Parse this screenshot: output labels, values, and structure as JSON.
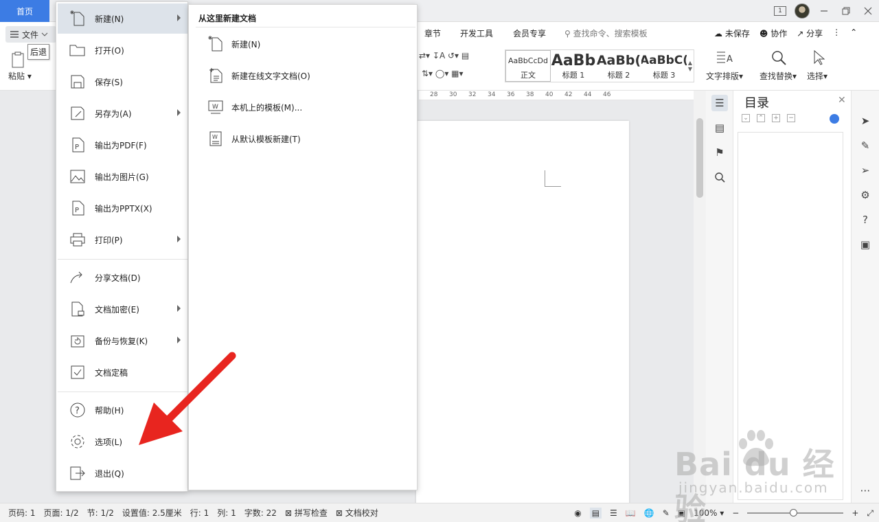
{
  "titlebar": {
    "home_tab": "首页",
    "badge": "1"
  },
  "ribbon": {
    "file_label": "文件",
    "tabs": {
      "chapter": "章节",
      "dev_tools": "开发工具",
      "member": "会员专享"
    },
    "search_cmd": "查找命令、搜索模板",
    "unsaved": "未保存",
    "collab": "协作",
    "share": "分享",
    "paste": "粘贴",
    "styles": [
      {
        "preview": "AaBbCcDd",
        "name": "正文"
      },
      {
        "preview": "AaBb",
        "name": "标题 1"
      },
      {
        "preview": "AaBb(",
        "name": "标题 2"
      },
      {
        "preview": "AaBbC(",
        "name": "标题 3"
      }
    ],
    "text_layout": "文字排版",
    "find_replace": "查找替换",
    "select": "选择"
  },
  "tooltip": "后退",
  "ruler_numbers": [
    "28",
    "30",
    "32",
    "34",
    "36",
    "38",
    "40",
    "42",
    "44",
    "46"
  ],
  "file_menu": [
    {
      "label": "新建(N)",
      "icon": "new-doc-icon"
    },
    {
      "label": "打开(O)",
      "icon": "folder-icon"
    },
    {
      "label": "保存(S)",
      "icon": "save-icon"
    },
    {
      "label": "另存为(A)",
      "icon": "save-as-icon"
    },
    {
      "label": "输出为PDF(F)",
      "icon": "pdf-icon"
    },
    {
      "label": "输出为图片(G)",
      "icon": "image-icon"
    },
    {
      "label": "输出为PPTX(X)",
      "icon": "pptx-icon"
    },
    {
      "label": "打印(P)",
      "icon": "printer-icon"
    },
    {
      "label": "分享文档(D)",
      "icon": "share-icon"
    },
    {
      "label": "文档加密(E)",
      "icon": "lock-doc-icon"
    },
    {
      "label": "备份与恢复(K)",
      "icon": "backup-icon"
    },
    {
      "label": "文档定稿",
      "icon": "finalize-icon"
    },
    {
      "label": "帮助(H)",
      "icon": "help-icon"
    },
    {
      "label": "选项(L)",
      "icon": "gear-icon"
    },
    {
      "label": "退出(Q)",
      "icon": "exit-icon"
    }
  ],
  "sub_menu": {
    "title": "从这里新建文档",
    "items": [
      {
        "label": "新建(N)"
      },
      {
        "label": "新建在线文字文档(O)"
      },
      {
        "label": "本机上的模板(M)..."
      },
      {
        "label": "从默认模板新建(T)"
      }
    ]
  },
  "toc": {
    "title": "目录"
  },
  "status": {
    "page_code": "页码: 1",
    "page": "页面: 1/2",
    "section": "节: 1/2",
    "setting": "设置值: 2.5厘米",
    "row": "行: 1",
    "col": "列: 1",
    "word_count": "字数: 22",
    "spell": "拼写检查",
    "proof": "文档校对",
    "zoom": "100%"
  },
  "watermark": {
    "logo": "Bai du 经验",
    "url": "jingyan.baidu.com"
  },
  "colors": {
    "accent": "#3c7ce4",
    "arrow": "#e8251f"
  }
}
